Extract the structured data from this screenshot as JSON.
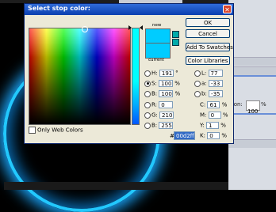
{
  "background_panel": {
    "field_value": "100",
    "field_unit": "%",
    "label_fragment": "tion:"
  },
  "dialog": {
    "title": "Select stop color:",
    "close_glyph": "✕",
    "swatch_new_label": "new",
    "swatch_current_label": "current",
    "buttons": {
      "ok": "OK",
      "cancel": "Cancel",
      "add_to_swatches": "Add To Swatches",
      "color_libraries": "Color Libraries"
    },
    "only_web_colors": "Only Web Colors",
    "hsb": {
      "h_label": "H:",
      "h_value": "191",
      "h_unit": "°",
      "s_label": "S:",
      "s_value": "100",
      "s_unit": "%",
      "b_label": "B:",
      "b_value": "100",
      "b_unit": "%"
    },
    "rgb": {
      "r_label": "R:",
      "r_value": "0",
      "g_label": "G:",
      "g_value": "210",
      "b_label": "B:",
      "b_value": "255"
    },
    "lab": {
      "l_label": "L:",
      "l_value": "77",
      "a_label": "a:",
      "a_value": "-33",
      "b_label": "b:",
      "b_value": "-35"
    },
    "cmyk": {
      "c_label": "C:",
      "c_value": "61",
      "c_unit": "%",
      "m_label": "M:",
      "m_value": "0",
      "m_unit": "%",
      "y_label": "Y:",
      "y_value": "1",
      "y_unit": "%",
      "k_label": "K:",
      "k_value": "0",
      "k_unit": "%"
    },
    "hex_prefix": "#",
    "hex_value": "00d2ff",
    "selected_color": "#00d2ff"
  }
}
